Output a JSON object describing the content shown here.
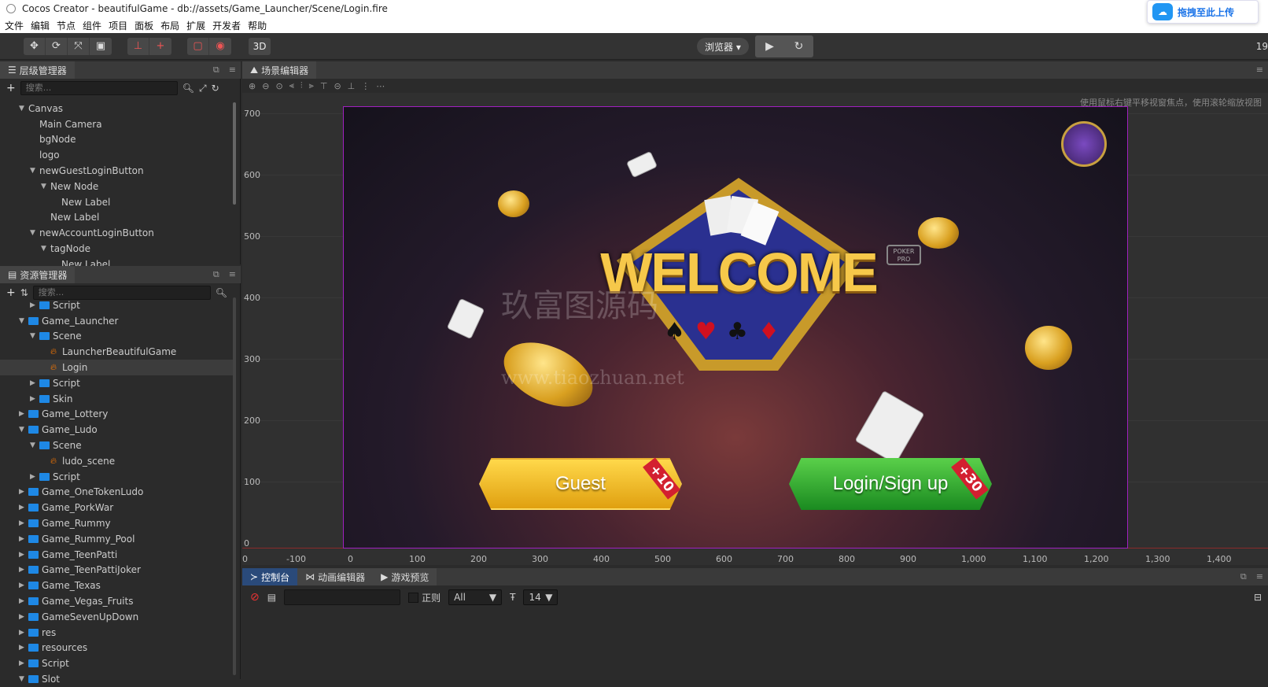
{
  "window": {
    "title": "Cocos Creator - beautifulGame - db://assets/Game_Launcher/Scene/Login.fire"
  },
  "upload_button": {
    "label": "拖拽至此上传"
  },
  "menu": [
    "文件",
    "编辑",
    "节点",
    "组件",
    "项目",
    "面板",
    "布局",
    "扩展",
    "开发者",
    "帮助"
  ],
  "toolbar": {
    "btn_3d": "3D",
    "browser": "浏览器 ▾",
    "resolution": "19"
  },
  "hierarchy": {
    "tab": "层级管理器",
    "search_placeholder": "搜索...",
    "nodes": [
      {
        "label": "Canvas",
        "indent": 1,
        "caret": "▼"
      },
      {
        "label": "Main Camera",
        "indent": 2,
        "caret": ""
      },
      {
        "label": "bgNode",
        "indent": 2,
        "caret": ""
      },
      {
        "label": "logo",
        "indent": 2,
        "caret": ""
      },
      {
        "label": "newGuestLoginButton",
        "indent": 2,
        "caret": "▼"
      },
      {
        "label": "New Node",
        "indent": 3,
        "caret": "▼"
      },
      {
        "label": "New Label",
        "indent": 4,
        "caret": ""
      },
      {
        "label": "New Label",
        "indent": 3,
        "caret": ""
      },
      {
        "label": "newAccountLoginButton",
        "indent": 2,
        "caret": "▼"
      },
      {
        "label": "tagNode",
        "indent": 3,
        "caret": "▼"
      },
      {
        "label": "New Label",
        "indent": 4,
        "caret": ""
      }
    ]
  },
  "assets": {
    "tab": "资源管理器",
    "search_placeholder": "搜索...",
    "items": [
      {
        "label": "Script",
        "indent": 2,
        "caret": "▶",
        "type": "folder"
      },
      {
        "label": "Game_Launcher",
        "indent": 1,
        "caret": "▼",
        "type": "folder"
      },
      {
        "label": "Scene",
        "indent": 2,
        "caret": "▼",
        "type": "folder"
      },
      {
        "label": "LauncherBeautifulGame",
        "indent": 3,
        "caret": "",
        "type": "fire"
      },
      {
        "label": "Login",
        "indent": 3,
        "caret": "",
        "type": "fire",
        "selected": true
      },
      {
        "label": "Script",
        "indent": 2,
        "caret": "▶",
        "type": "folder"
      },
      {
        "label": "Skin",
        "indent": 2,
        "caret": "▶",
        "type": "folder"
      },
      {
        "label": "Game_Lottery",
        "indent": 1,
        "caret": "▶",
        "type": "folder"
      },
      {
        "label": "Game_Ludo",
        "indent": 1,
        "caret": "▼",
        "type": "folder"
      },
      {
        "label": "Scene",
        "indent": 2,
        "caret": "▼",
        "type": "folder"
      },
      {
        "label": "ludo_scene",
        "indent": 3,
        "caret": "",
        "type": "fire"
      },
      {
        "label": "Script",
        "indent": 2,
        "caret": "▶",
        "type": "folder"
      },
      {
        "label": "Game_OneTokenLudo",
        "indent": 1,
        "caret": "▶",
        "type": "folder"
      },
      {
        "label": "Game_PorkWar",
        "indent": 1,
        "caret": "▶",
        "type": "folder"
      },
      {
        "label": "Game_Rummy",
        "indent": 1,
        "caret": "▶",
        "type": "folder"
      },
      {
        "label": "Game_Rummy_Pool",
        "indent": 1,
        "caret": "▶",
        "type": "folder"
      },
      {
        "label": "Game_TeenPatti",
        "indent": 1,
        "caret": "▶",
        "type": "folder"
      },
      {
        "label": "Game_TeenPattiJoker",
        "indent": 1,
        "caret": "▶",
        "type": "folder"
      },
      {
        "label": "Game_Texas",
        "indent": 1,
        "caret": "▶",
        "type": "folder"
      },
      {
        "label": "Game_Vegas_Fruits",
        "indent": 1,
        "caret": "▶",
        "type": "folder"
      },
      {
        "label": "GameSevenUpDown",
        "indent": 1,
        "caret": "▶",
        "type": "folder"
      },
      {
        "label": "res",
        "indent": 1,
        "caret": "▶",
        "type": "folder"
      },
      {
        "label": "resources",
        "indent": 1,
        "caret": "▶",
        "type": "folder"
      },
      {
        "label": "Script",
        "indent": 1,
        "caret": "▶",
        "type": "folder"
      },
      {
        "label": "Slot",
        "indent": 1,
        "caret": "▼",
        "type": "folder"
      }
    ]
  },
  "scene": {
    "tab": "场景编辑器",
    "hint": "使用鼠标右键平移视窗焦点，使用滚轮缩放视图",
    "y_ticks": [
      "700",
      "600",
      "500",
      "400",
      "300",
      "200",
      "100",
      "0"
    ],
    "x_ticks": [
      "0",
      "-100",
      "0",
      "100",
      "200",
      "300",
      "400",
      "500",
      "600",
      "700",
      "800",
      "900",
      "1,000",
      "1,100",
      "1,200",
      "1,300",
      "1,400"
    ],
    "game": {
      "welcome": "WELCOME",
      "guest_label": "Guest",
      "guest_bonus": "+10",
      "login_label": "Login/Sign up",
      "login_bonus": "+30",
      "poker_sign": "POKER PRO",
      "watermark_cn": "玖富图源码",
      "watermark_url": "www.tiaozhuan.net"
    }
  },
  "console": {
    "tabs": [
      "控制台",
      "动画编辑器",
      "游戏预览"
    ],
    "regex_label": "正则",
    "level_select": "All",
    "font_size": "14"
  },
  "colors": {
    "accent": "#2a4a7a",
    "frame": "#a020c0"
  }
}
